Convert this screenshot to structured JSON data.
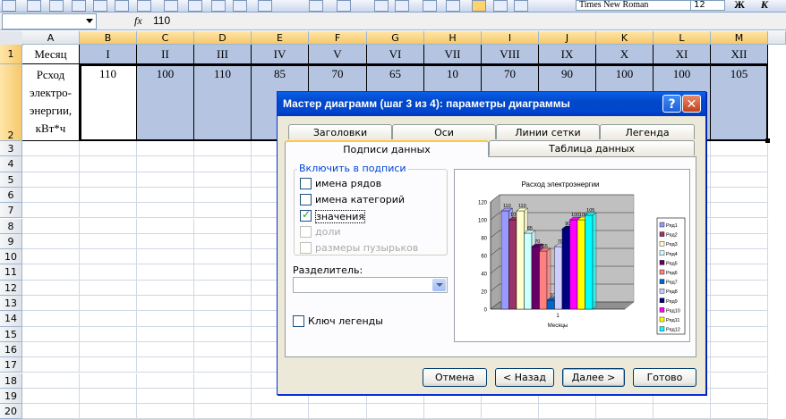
{
  "toolbar": {
    "font_name": "Times New Roman",
    "font_size": "12",
    "bold": "Ж",
    "italic": "К"
  },
  "formula_bar": {
    "fx": "fx",
    "value": "110"
  },
  "sheet": {
    "columns": [
      "A",
      "B",
      "C",
      "D",
      "E",
      "F",
      "G",
      "H",
      "I",
      "J",
      "K",
      "L",
      "M"
    ],
    "rows": [
      "1",
      "2",
      "3",
      "4",
      "5",
      "6",
      "7",
      "8",
      "9",
      "10",
      "11",
      "12",
      "13",
      "14",
      "15",
      "16",
      "17",
      "18",
      "19",
      "20"
    ],
    "row1": [
      "Месяц",
      "I",
      "II",
      "III",
      "IV",
      "V",
      "VI",
      "VII",
      "VIII",
      "IX",
      "X",
      "XI",
      "XII"
    ],
    "row2_label": [
      "Рсход",
      "электро-",
      "энергии,",
      "кВт*ч"
    ],
    "row2_values": [
      "110",
      "100",
      "110",
      "85",
      "70",
      "65",
      "10",
      "70",
      "90",
      "100",
      "100",
      "105"
    ]
  },
  "dialog": {
    "title": "Мастер диаграмм (шаг 3 из 4): параметры диаграммы",
    "help": "?",
    "close": "✕",
    "tabs_top": [
      "Заголовки",
      "Оси",
      "Линии сетки",
      "Легенда"
    ],
    "tabs_bottom": [
      "Подписи данных",
      "Таблица данных"
    ],
    "group_title": "Включить в подписи",
    "options": [
      {
        "label": "имена рядов",
        "checked": false,
        "disabled": false
      },
      {
        "label": "имена категорий",
        "checked": false,
        "disabled": false
      },
      {
        "label": "значения",
        "checked": true,
        "disabled": false
      },
      {
        "label": "доли",
        "checked": false,
        "disabled": true
      },
      {
        "label": "размеры пузырьков",
        "checked": false,
        "disabled": true
      }
    ],
    "separator_label": "Разделитель:",
    "separator_value": "",
    "legend_key_label": "Ключ легенды",
    "buttons": [
      "Отмена",
      "< Назад",
      "Далее >",
      "Готово"
    ]
  },
  "chart_data": {
    "type": "bar",
    "title": "Расход электроэнергии",
    "xlabel": "Месяцы",
    "categories": [
      "1"
    ],
    "ylim": [
      0,
      120
    ],
    "yticks": [
      "0",
      "20",
      "40",
      "60",
      "80",
      "100",
      "120"
    ],
    "series": [
      {
        "name": "Ряд1",
        "values": [
          110
        ]
      },
      {
        "name": "Ряд2",
        "values": [
          100
        ]
      },
      {
        "name": "Ряд3",
        "values": [
          110
        ]
      },
      {
        "name": "Ряд4",
        "values": [
          85
        ]
      },
      {
        "name": "Ряд5",
        "values": [
          70
        ]
      },
      {
        "name": "Ряд6",
        "values": [
          65
        ]
      },
      {
        "name": "Ряд7",
        "values": [
          10
        ]
      },
      {
        "name": "Ряд8",
        "values": [
          70
        ]
      },
      {
        "name": "Ряд9",
        "values": [
          90
        ]
      },
      {
        "name": "Ряд10",
        "values": [
          100
        ]
      },
      {
        "name": "Ряд11",
        "values": [
          100
        ]
      },
      {
        "name": "Ряд12",
        "values": [
          105
        ]
      }
    ],
    "colors": [
      "#9999ff",
      "#993366",
      "#ffffcc",
      "#ccffff",
      "#660066",
      "#ff8080",
      "#0066cc",
      "#ccccff",
      "#000080",
      "#ff00ff",
      "#ffff00",
      "#00ffff"
    ],
    "legend": "right"
  }
}
